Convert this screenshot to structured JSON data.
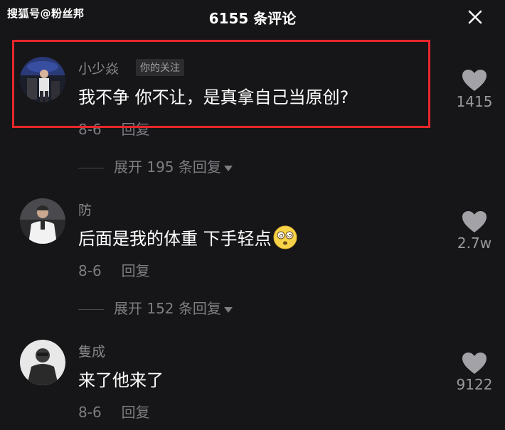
{
  "watermark": "搜狐号@粉丝邦",
  "header": {
    "title": "6155 条评论",
    "close_icon": "close-icon"
  },
  "comments": [
    {
      "author": "小少焱",
      "badge": "你的关注",
      "text": "我不争 你不让，是真拿自己当原创?",
      "date": "8-6",
      "reply_label": "回复",
      "likes": "1415",
      "expand_label": "展开 195 条回复"
    },
    {
      "author": "防",
      "text": "后面是我的体重 下手轻点",
      "emoji": "dizzy-face-emoji",
      "date": "8-6",
      "reply_label": "回复",
      "likes": "2.7w",
      "expand_label": "展开 152 条回复"
    },
    {
      "author": "隻成",
      "text": "来了他来了",
      "date": "8-6",
      "reply_label": "回复",
      "likes": "9122"
    }
  ],
  "colors": {
    "background": "#161618",
    "highlight": "#e8262b",
    "muted_text": "#7d7d82"
  }
}
